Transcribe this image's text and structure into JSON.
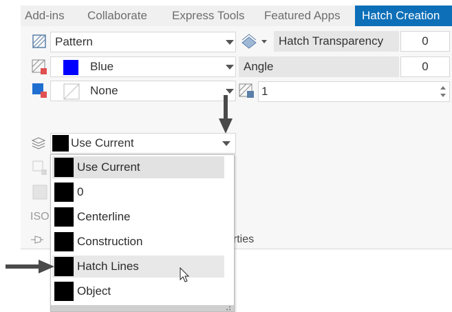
{
  "tabs": [
    {
      "label": "Add-ins",
      "active": false
    },
    {
      "label": "Collaborate",
      "active": false
    },
    {
      "label": "Express Tools",
      "active": false
    },
    {
      "label": "Featured Apps",
      "active": false
    },
    {
      "label": "Hatch Creation",
      "active": true
    }
  ],
  "hatch_type": {
    "value": "Pattern"
  },
  "hatch_color": {
    "value": "Blue",
    "swatch": "#0000ff"
  },
  "background_color": {
    "value": "None"
  },
  "layer": {
    "value": "Use Current"
  },
  "transparency": {
    "label": "Hatch Transparency",
    "value": "0"
  },
  "angle": {
    "label": "Angle",
    "value": "0"
  },
  "scale": {
    "value": "1"
  },
  "side_text": {
    "iso": "ISO"
  },
  "properties_label_fragment": "erties",
  "layer_dropdown": {
    "items": [
      {
        "label": "Use Current",
        "state": "selected"
      },
      {
        "label": "0",
        "state": "normal"
      },
      {
        "label": "Centerline",
        "state": "normal"
      },
      {
        "label": "Construction",
        "state": "normal"
      },
      {
        "label": "Hatch Lines",
        "state": "hover"
      },
      {
        "label": "Object",
        "state": "normal"
      }
    ]
  },
  "colors": {
    "accent_tab": "#0d6fb8",
    "arrow": "#4a4a4a"
  }
}
